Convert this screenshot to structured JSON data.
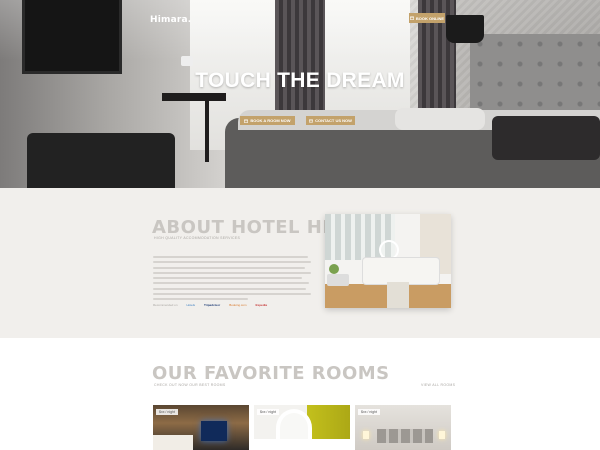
{
  "header": {
    "brand": "Himara.",
    "book_online": "BOOK ONLINE"
  },
  "hero": {
    "title": "TOUCH THE DREAM",
    "book_button": "BOOK A ROOM NOW",
    "contact_button": "CONTACT US NOW"
  },
  "about": {
    "title": "ABOUT HOTEL HIMARA.",
    "subtitle": "HIGH QUALITY ACCOMMODATION SERVICES",
    "partners": {
      "label": "Recommended on",
      "items": [
        "Hotels",
        "Tripadvisor",
        "Booking.com",
        "Expedia"
      ]
    }
  },
  "rooms": {
    "title": "OUR FAVORITE ROOMS",
    "subtitle": "CHECK OUT NOW OUR BEST ROOMS",
    "view_all": "VIEW ALL ROOMS",
    "cards": [
      {
        "price": "$xx / night"
      },
      {
        "price": "$xx / night"
      },
      {
        "price": "$xx / night"
      }
    ]
  },
  "colors": {
    "accent": "#c3a26b",
    "heading_muted": "#c9c6c2"
  },
  "icons": {
    "book_online": "calendar-icon",
    "book_room": "calendar-icon",
    "contact": "envelope-icon"
  }
}
